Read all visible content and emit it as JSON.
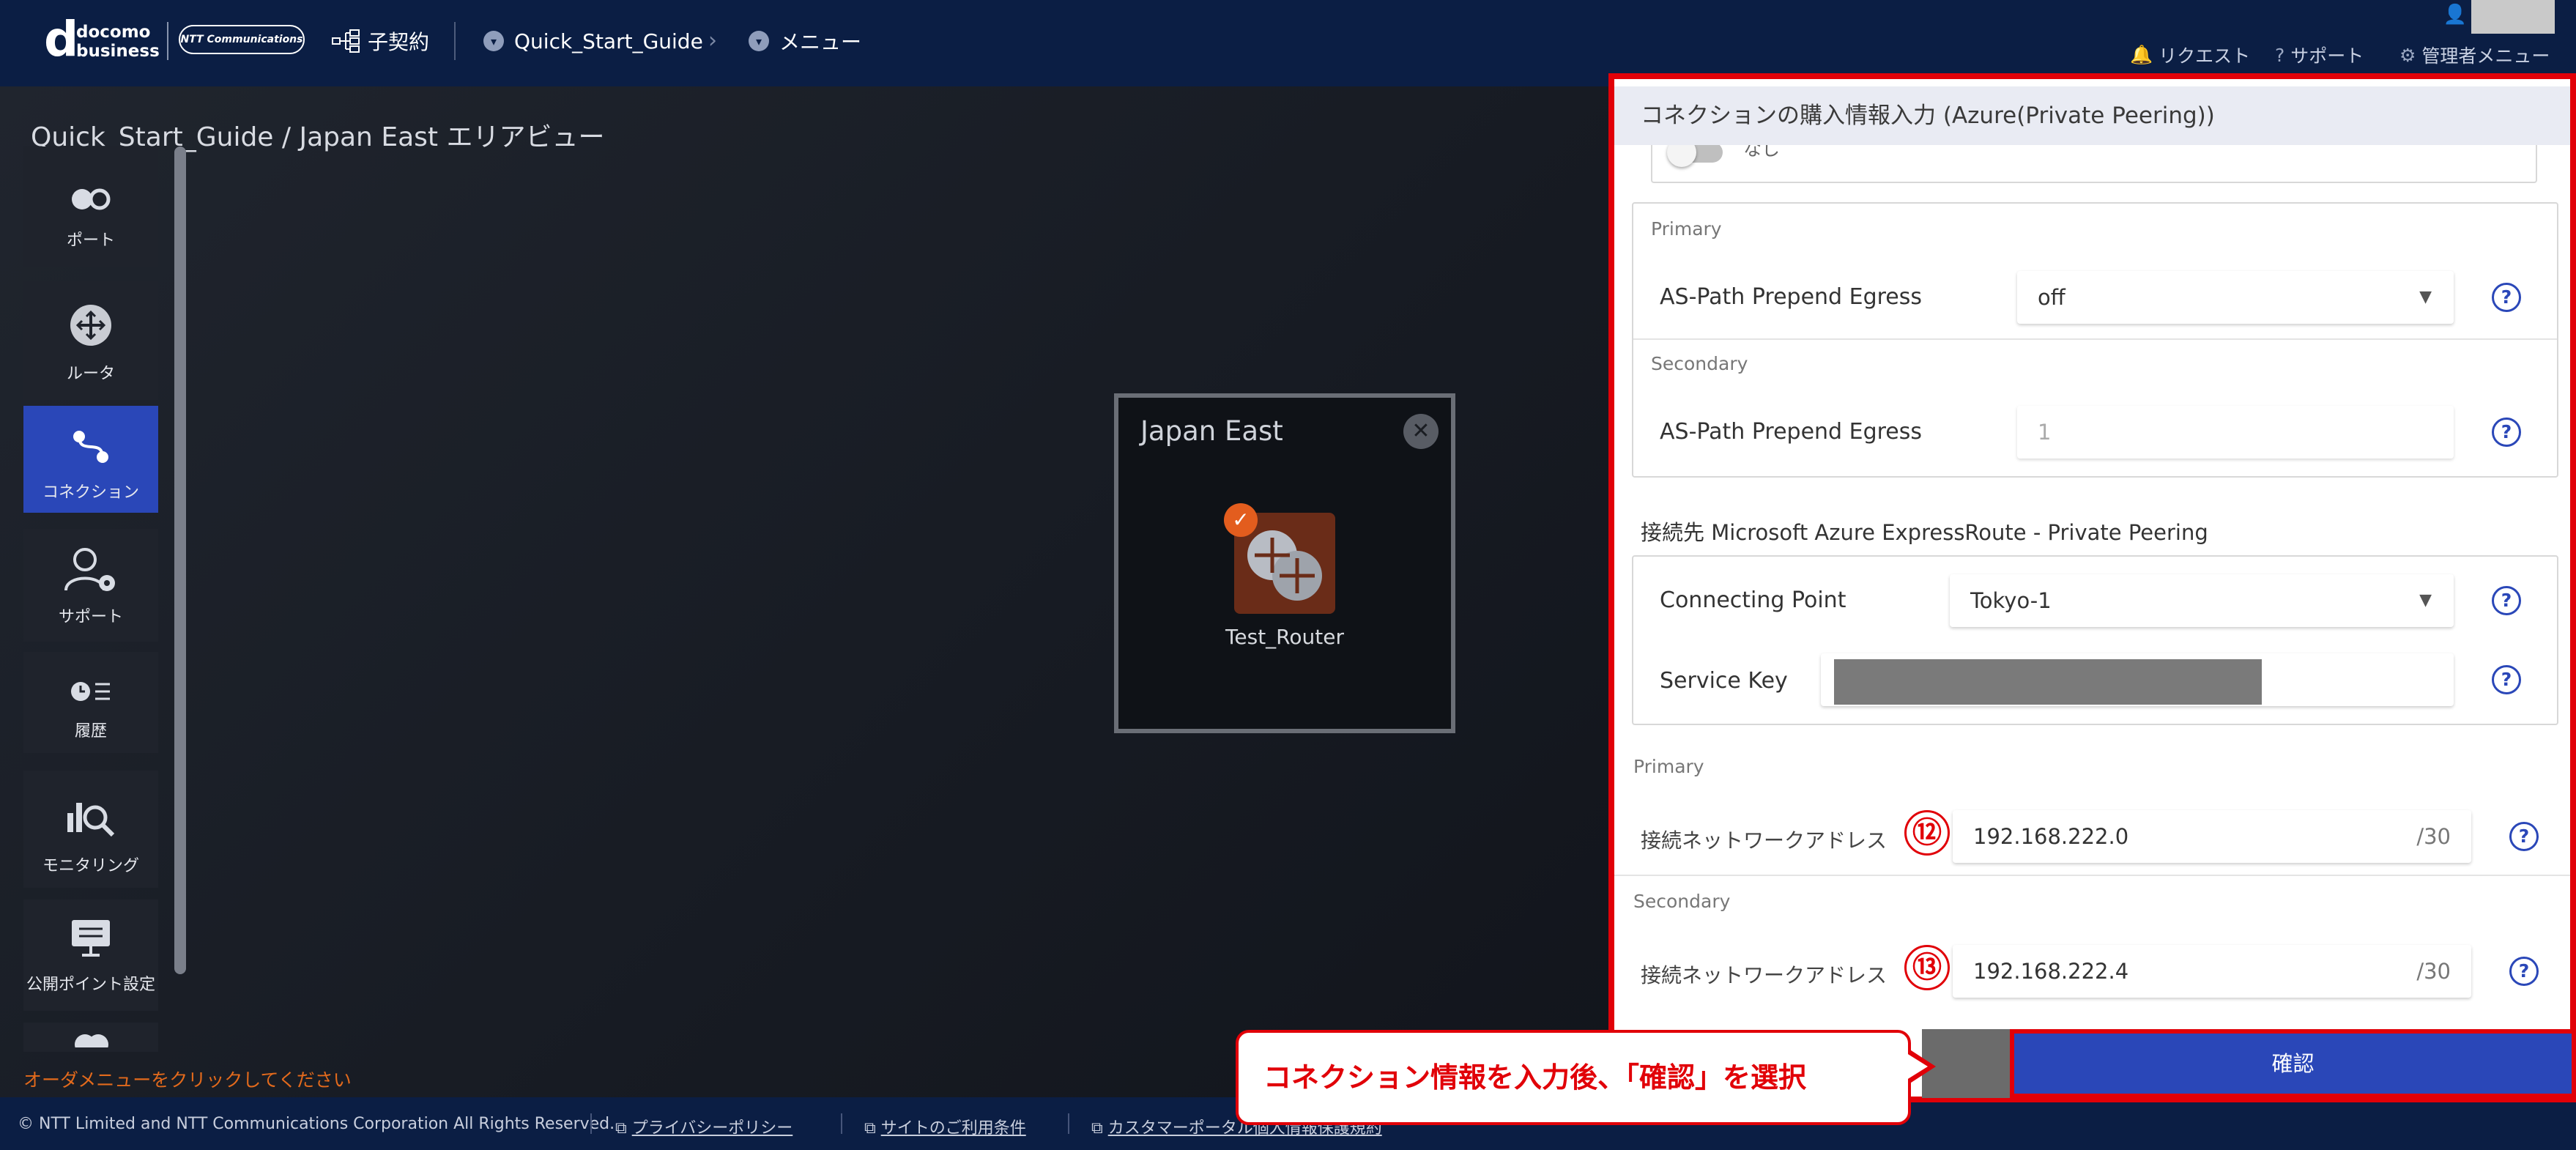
{
  "header": {
    "logo_docomo_d": "d",
    "logo_docomo_line1": "docomo",
    "logo_docomo_line2": "business",
    "logo_ntt": "NTT Communications",
    "contract": "子契約",
    "breadcrumb_project": "Quick_Start_Guide",
    "menu": "メニュー",
    "request": "リクエスト",
    "support": "サポート",
    "admin_menu": "管理者メニュー"
  },
  "area": {
    "title": "Quick_Start_Guide / Japan East エリアビュー"
  },
  "sidebar": {
    "items": [
      {
        "label": "ポート",
        "icon": "port-icon"
      },
      {
        "label": "ルータ",
        "icon": "router-icon"
      },
      {
        "label": "コネクション",
        "icon": "connection-icon"
      },
      {
        "label": "サポート",
        "icon": "support-user-icon"
      },
      {
        "label": "履歴",
        "icon": "history-icon"
      },
      {
        "label": "モニタリング",
        "icon": "monitoring-icon"
      },
      {
        "label": "公開ポイント設定",
        "icon": "public-point-icon"
      }
    ]
  },
  "order_hint": "オーダメニューをクリックしてください",
  "node": {
    "title": "Japan East",
    "router_label": "Test_Router"
  },
  "panel": {
    "title": "コネクションの購入情報入力 (Azure(Private Peering))",
    "toggle_label": "なし",
    "primary_label": "Primary",
    "secondary_label": "Secondary",
    "as_path_label": "AS-Path Prepend Egress",
    "as_path_primary_value": "off",
    "as_path_secondary_value": "1",
    "destination_heading": "接続先 Microsoft Azure ExpressRoute - Private Peering",
    "connecting_point_label": "Connecting Point",
    "connecting_point_value": "Tokyo-1",
    "service_key_label": "Service Key",
    "network_primary_label": "Primary",
    "network_secondary_label": "Secondary",
    "network_address_label": "接続ネットワークアドレス",
    "network_primary_value": "192.168.222.0",
    "network_secondary_value": "192.168.222.4",
    "prefix_suffix": "/30",
    "confirm_button": "確認",
    "help_glyph": "?"
  },
  "annotation": {
    "callout": "コネクション情報を入力後、「確認」を選択",
    "marker_12": "⑫",
    "marker_13": "⑬"
  },
  "footer": {
    "copyright": "© NTT Limited and NTT Communications Corporation All Rights Reserved.",
    "privacy": "プライバシーポリシー",
    "terms": "サイトのご利用条件",
    "customer_portal": "カスタマーポータル個人情報保護規約"
  },
  "colors": {
    "header_bg": "#0b1e44",
    "accent_blue": "#2a47b8",
    "annotation_red": "#e10008",
    "hint_orange": "#e36a1c"
  }
}
